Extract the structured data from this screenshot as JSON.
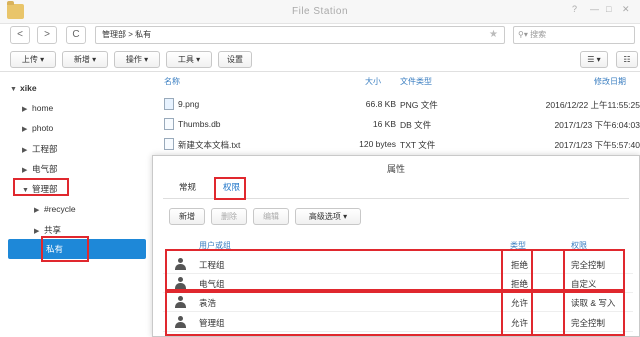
{
  "window": {
    "title": "File Station"
  },
  "nav": {
    "back": "<",
    "forward": ">",
    "refresh": "C",
    "path": "管理部 > 私有",
    "search_placeholder": "搜索"
  },
  "toolbar": {
    "upload": "上传 ▾",
    "new": "新增 ▾",
    "action": "操作 ▾",
    "tools": "工具 ▾",
    "settings": "设置"
  },
  "sidebar": {
    "root": "xike",
    "items": [
      "home",
      "photo",
      "工程部",
      "电气部",
      "管理部",
      "#recycle",
      "共享",
      "私有"
    ]
  },
  "file_list": {
    "headers": {
      "name": "名称",
      "size": "大小",
      "type": "文件类型",
      "modified": "修改日期"
    },
    "rows": [
      {
        "name": "9.png",
        "size": "66.8 KB",
        "type": "PNG 文件",
        "modified": "2016/12/22 上午11:55:25"
      },
      {
        "name": "Thumbs.db",
        "size": "16 KB",
        "type": "DB 文件",
        "modified": "2017/1/23 下午6:04:03"
      },
      {
        "name": "新建文本文档.txt",
        "size": "120 bytes",
        "type": "TXT 文件",
        "modified": "2017/1/23 下午5:57:40"
      }
    ]
  },
  "dialog": {
    "title": "属性",
    "tabs": [
      "常规",
      "权限"
    ],
    "buttons": {
      "add": "新增",
      "delete": "删除",
      "edit": "编辑",
      "advanced": "高级选项 ▾"
    },
    "headers": {
      "user": "用户或组",
      "type": "类型",
      "permission": "权限"
    },
    "rows": [
      {
        "user": "工程组",
        "type": "拒绝",
        "permission": "完全控制"
      },
      {
        "user": "电气组",
        "type": "拒绝",
        "permission": "自定义"
      },
      {
        "user": "袁浩",
        "type": "允许",
        "permission": "读取 & 写入"
      },
      {
        "user": "管理组",
        "type": "允许",
        "permission": "完全控制"
      }
    ]
  },
  "colors": {
    "accent": "#1e88d8",
    "annotation": "#e0282e"
  }
}
